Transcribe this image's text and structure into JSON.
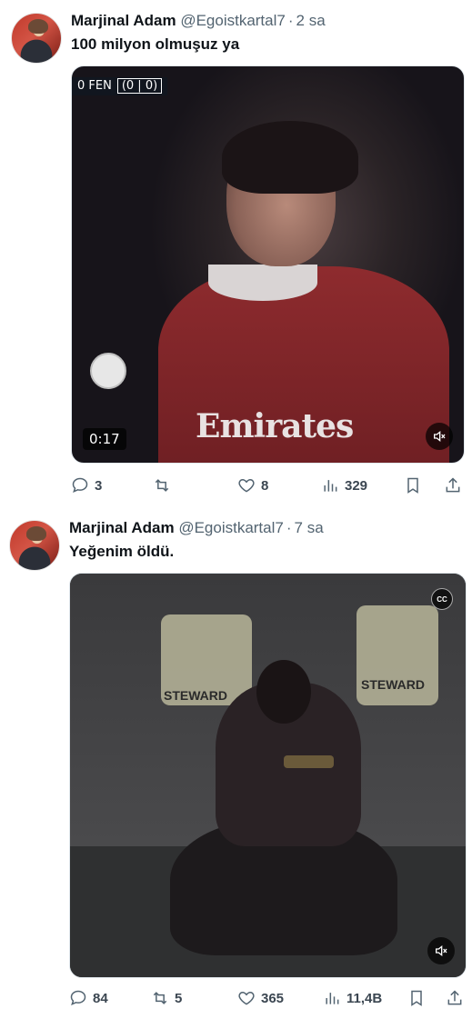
{
  "tweets": [
    {
      "author_name": "Marjinal Adam",
      "handle": "@Egoistkartal7",
      "separator": "·",
      "time": "2 sa",
      "text": "100 milyon olmuşuz ya",
      "media": {
        "scorebug_left": "0  FEN",
        "scorebug_score": "(0 | 0)",
        "shirt_text": "Emirates",
        "duration": "0:17"
      },
      "actions": {
        "replies": "3",
        "reposts": "",
        "likes": "8",
        "views": "329"
      }
    },
    {
      "author_name": "Marjinal Adam",
      "handle": "@Egoistkartal7",
      "separator": "·",
      "time": "7 sa",
      "text": "Yeğenim öldü.",
      "media": {
        "steward_left": "STEWARD",
        "steward_right": "STEWARD",
        "cc_label": "CC"
      },
      "actions": {
        "replies": "84",
        "reposts": "5",
        "likes": "365",
        "views": "11,4B"
      }
    }
  ],
  "icons": {
    "reply": "reply-icon",
    "repost": "repost-icon",
    "like": "like-icon",
    "views": "views-icon",
    "bookmark": "bookmark-icon",
    "share": "share-icon",
    "mute": "mute-icon"
  },
  "colors": {
    "text": "#0f1419",
    "secondary": "#536471"
  }
}
